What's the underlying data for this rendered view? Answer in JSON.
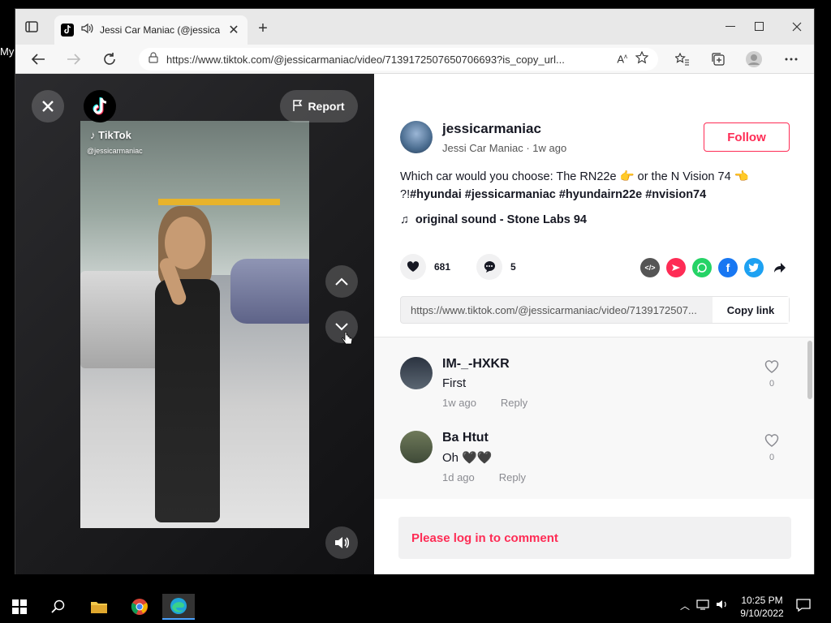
{
  "desktop": {
    "label": "My"
  },
  "browser": {
    "tab_title": "Jessi Car Maniac (@jessicarmaniac",
    "url": "https://www.tiktok.com/@jessicarmaniac/video/7139172507650706693?is_copy_url..."
  },
  "video": {
    "report_label": "Report",
    "watermark_brand": "TikTok",
    "watermark_user": "@jessicarmaniac"
  },
  "author": {
    "username": "jessicarmaniac",
    "display_name": "Jessi Car Maniac",
    "time": "1w ago",
    "follow_label": "Follow"
  },
  "description": {
    "text_a": "Which car would you choose: The RN22e",
    "text_b": "or the N Vision 74",
    "text_c": "?!",
    "hashtags": "#hyundai #jessicarmaniac #hyundairn22e #nvision74"
  },
  "sound": {
    "label": "original sound - Stone Labs 94"
  },
  "stats": {
    "likes": "681",
    "comments": "5"
  },
  "share": {
    "link_url": "https://www.tiktok.com/@jessicarmaniac/video/7139172507...",
    "copy_label": "Copy link"
  },
  "comments": [
    {
      "user": "IM-_-HXKR",
      "text": "First",
      "time": "1w ago",
      "reply": "Reply",
      "likes": "0"
    },
    {
      "user": "Ba Htut",
      "text": "Oh 🖤🖤",
      "time": "1d ago",
      "reply": "Reply",
      "likes": "0"
    }
  ],
  "login_prompt": "Please log in to comment",
  "taskbar": {
    "time": "10:25 PM",
    "date": "9/10/2022"
  },
  "colors": {
    "accent": "#fe2c55",
    "text": "#161823"
  }
}
